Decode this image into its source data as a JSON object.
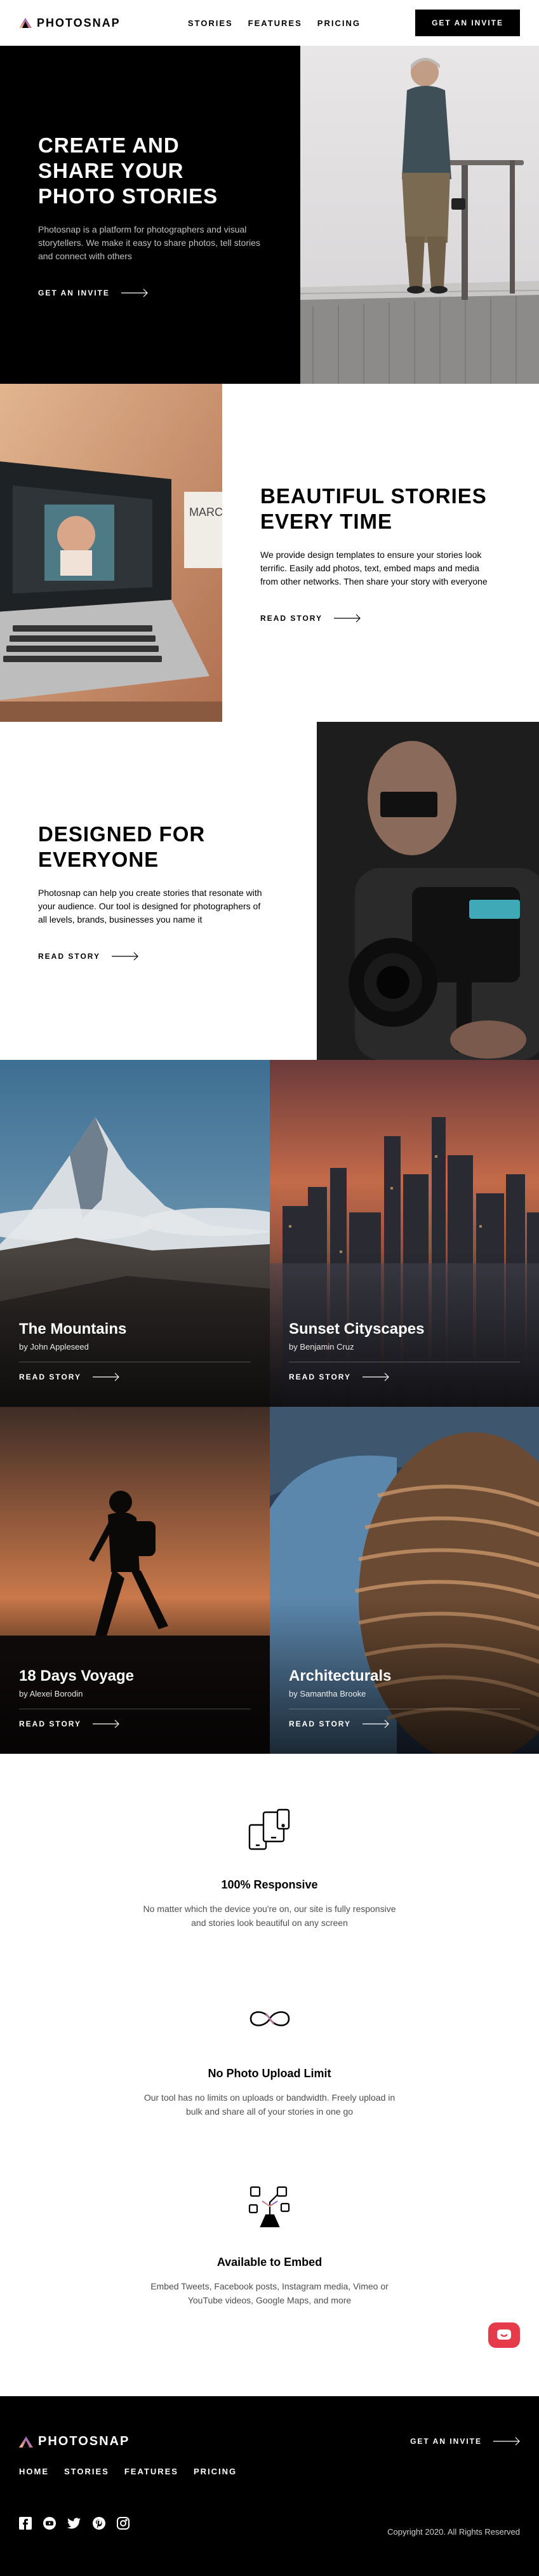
{
  "header": {
    "brand": "PHOTOSNAP",
    "nav": [
      "STORIES",
      "FEATURES",
      "PRICING"
    ],
    "cta": "GET AN INVITE"
  },
  "hero": {
    "title": "CREATE AND SHARE YOUR PHOTO STORIES",
    "text": "Photosnap is a platform for photographers and visual storytellers. We make it easy to share photos, tell stories and connect with others",
    "cta": "GET AN INVITE"
  },
  "section2": {
    "title": "BEAUTIFUL STORIES EVERY TIME",
    "text": "We provide design templates to ensure your stories look terrific. Easily add photos, text, embed maps and media from other networks. Then share your story with everyone",
    "cta": "READ STORY"
  },
  "section3": {
    "title": "DESIGNED FOR EVERYONE",
    "text": "Photosnap can help you create stories that resonate with your audience. Our tool is designed for photographers of all levels, brands, businesses you name it",
    "cta": "READ STORY"
  },
  "stories": [
    {
      "title": "The Mountains",
      "author": "by John Appleseed",
      "cta": "READ STORY"
    },
    {
      "title": "Sunset Cityscapes",
      "author": "by Benjamin Cruz",
      "cta": "READ STORY"
    },
    {
      "title": "18 Days Voyage",
      "author": "by Alexei Borodin",
      "cta": "READ STORY"
    },
    {
      "title": "Architecturals",
      "author": "by Samantha Brooke",
      "cta": "READ STORY"
    }
  ],
  "features": [
    {
      "icon": "responsive-devices-icon",
      "title": "100% Responsive",
      "text": "No matter which the device you're on, our site is fully responsive and stories look beautiful on any screen"
    },
    {
      "icon": "infinity-icon",
      "title": "No Photo Upload Limit",
      "text": "Our tool has no limits on uploads or bandwidth. Freely upload in bulk and share all of your stories in one go"
    },
    {
      "icon": "embed-icon",
      "title": "Available to Embed",
      "text": "Embed Tweets, Facebook posts, Instagram media, Vimeo or YouTube videos, Google Maps, and more"
    }
  ],
  "footer": {
    "brand": "PHOTOSNAP",
    "nav": [
      "HOME",
      "STORIES",
      "FEATURES",
      "PRICING"
    ],
    "cta": "GET AN INVITE",
    "social": [
      "facebook-icon",
      "youtube-icon",
      "twitter-icon",
      "pinterest-icon",
      "instagram-icon"
    ],
    "copyright": "Copyright 2020. All Rights Reserved"
  },
  "colors": {
    "accent_start": "#FFC593",
    "accent_mid": "#BC7198",
    "accent_end": "#5A77FF",
    "chat": "#E53B4A"
  }
}
